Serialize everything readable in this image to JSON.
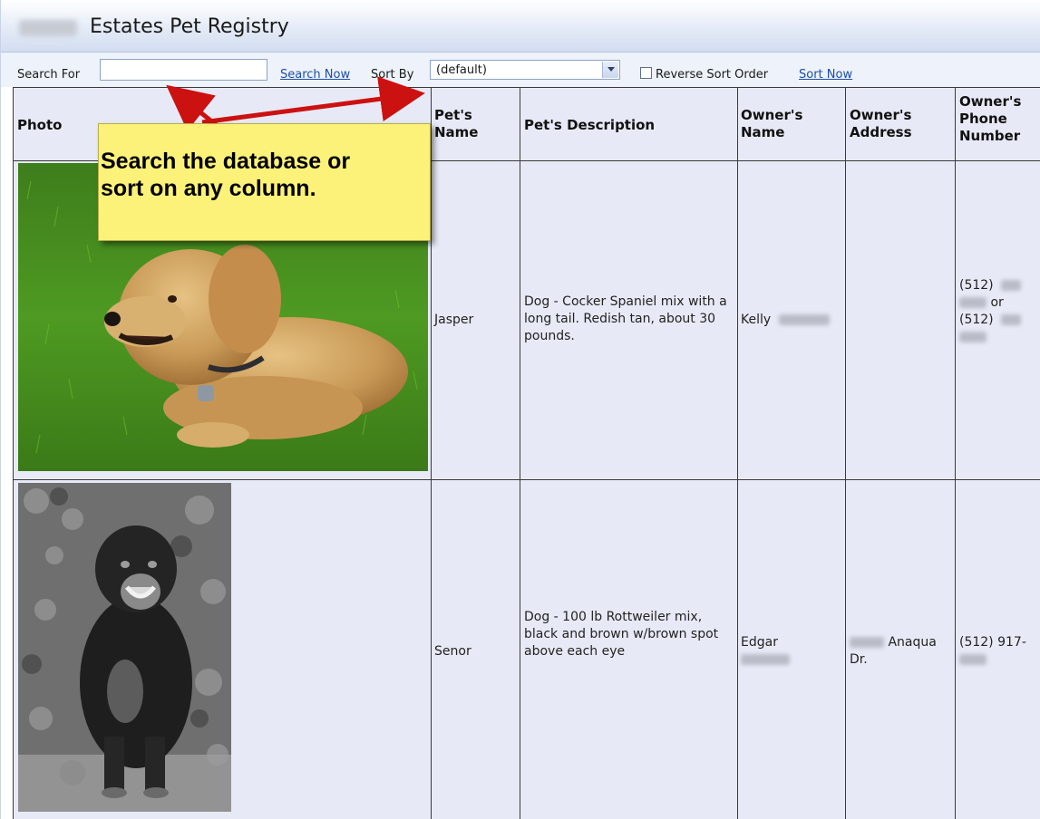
{
  "app": {
    "title": "Estates Pet Registry"
  },
  "toolbar": {
    "search_label": "Search For",
    "search_value": "",
    "search_now": "Search Now",
    "sort_label": "Sort By",
    "sort_value": "(default)",
    "reverse_label": "Reverse Sort Order",
    "reverse_checked": false,
    "sort_now": "Sort Now"
  },
  "table": {
    "headers": {
      "photo": "Photo",
      "pet_name": "Pet's Name",
      "pet_desc": "Pet's Description",
      "owner_name": "Owner's Name",
      "owner_address": "Owner's Address",
      "owner_phone": "Owner's Phone Number"
    },
    "rows": [
      {
        "pet_name": "Jasper",
        "description": "Dog - Cocker Spaniel mix with a long tail. Redish tan, about 30 pounds.",
        "owner_first": "Kelly",
        "address_street": "",
        "phone_line1": "(512)",
        "phone_or": "or",
        "phone_line3": "(512)",
        "photo_icon": "golden-dog-photo"
      },
      {
        "pet_name": "Senor",
        "description": "Dog - 100 lb Rottweiler mix, black and brown w/brown spot above each eye",
        "owner_first": "Edgar",
        "address_street": "Anaqua",
        "address_suffix": "Dr.",
        "phone_line1": "(512) 917-",
        "photo_icon": "rottweiler-bw-photo"
      }
    ]
  },
  "callout": {
    "text_line1": "Search the database or",
    "text_line2": "sort on any column."
  },
  "colors": {
    "link": "#1b4fa8",
    "callout_bg": "#fcf27a",
    "arrow": "#cc1111",
    "table_bg": "#e7eaf6"
  }
}
